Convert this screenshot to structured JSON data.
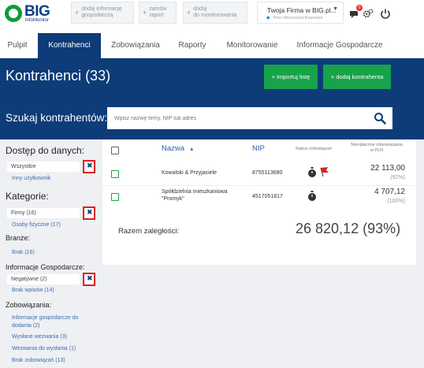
{
  "header": {
    "logo_big": "BIG",
    "logo_sub": "InfoMonitor",
    "quick_actions": [
      {
        "label": "dodaj informację\ngospodarczą"
      },
      {
        "label": "zamów\nraport"
      },
      {
        "label": "dodaj\ndo monitorowania"
      }
    ],
    "company_name": "Twoja Firma w BIG.pl...",
    "company_sub": "firma Wierzyciela-finansowa",
    "notification_count": "0"
  },
  "nav": {
    "tabs": [
      {
        "label": "Pulpit",
        "active": false
      },
      {
        "label": "Kontrahenci",
        "active": true
      },
      {
        "label": "Zobowiązania",
        "active": false
      },
      {
        "label": "Raporty",
        "active": false
      },
      {
        "label": "Monitorowanie",
        "active": false
      },
      {
        "label": "Informacje Gospodarcze",
        "active": false
      }
    ]
  },
  "banner": {
    "title": "Kontrahenci (33)",
    "import_button": "+ importuj listę",
    "add_button": "+ dodaj kontrahenta",
    "search_label": "Szukaj kontrahentów:",
    "search_placeholder": "Wpisz nazwę firmy, NIP lub adres"
  },
  "sidebar": {
    "access_heading": "Dostęp do danych:",
    "access_selected": "Wszystkie",
    "access_other": "Inny użytkownik",
    "category_heading": "Kategorie:",
    "category_selected": "Firmy (16)",
    "category_other": "Osoby fizyczne (17)",
    "industry_heading": "Branże:",
    "industry_link": "Brak (16)",
    "info_heading": "Informacje Gospodarcze:",
    "info_selected": "Negatywne (2)",
    "info_other": "Brak wpisów (14)",
    "obligations_heading": "Zobowiązania:",
    "obligations_links": [
      "Informacje gospodarcze do\ndodania (2)",
      "Wysłane wezwania (3)",
      "Wezwania do wysłania (1)",
      "Brak zobowiązań (13)"
    ]
  },
  "table": {
    "col_name": "Nazwa",
    "col_nip": "NIP",
    "col_status": "Status zobowiązań",
    "col_unpaid": "Nieopłacone zobowiązania\nw PLN",
    "rows": [
      {
        "name": "Kowalski & Przyjaciele",
        "nip": "8755113680",
        "amount": "22 113,00",
        "pct": "(92%)"
      },
      {
        "name": "Spółdzielnia mieszkaniowa\n\"Promyk\"",
        "nip": "4517051817",
        "amount": "4 707,12",
        "pct": "(100%)"
      }
    ],
    "total_label": "Razem zaległości:",
    "total_value": "26 820,12 (93%)"
  },
  "colors": {
    "brand_blue": "#0d3c78",
    "accent_green": "#17a34a",
    "highlight_red": "#e02020"
  }
}
